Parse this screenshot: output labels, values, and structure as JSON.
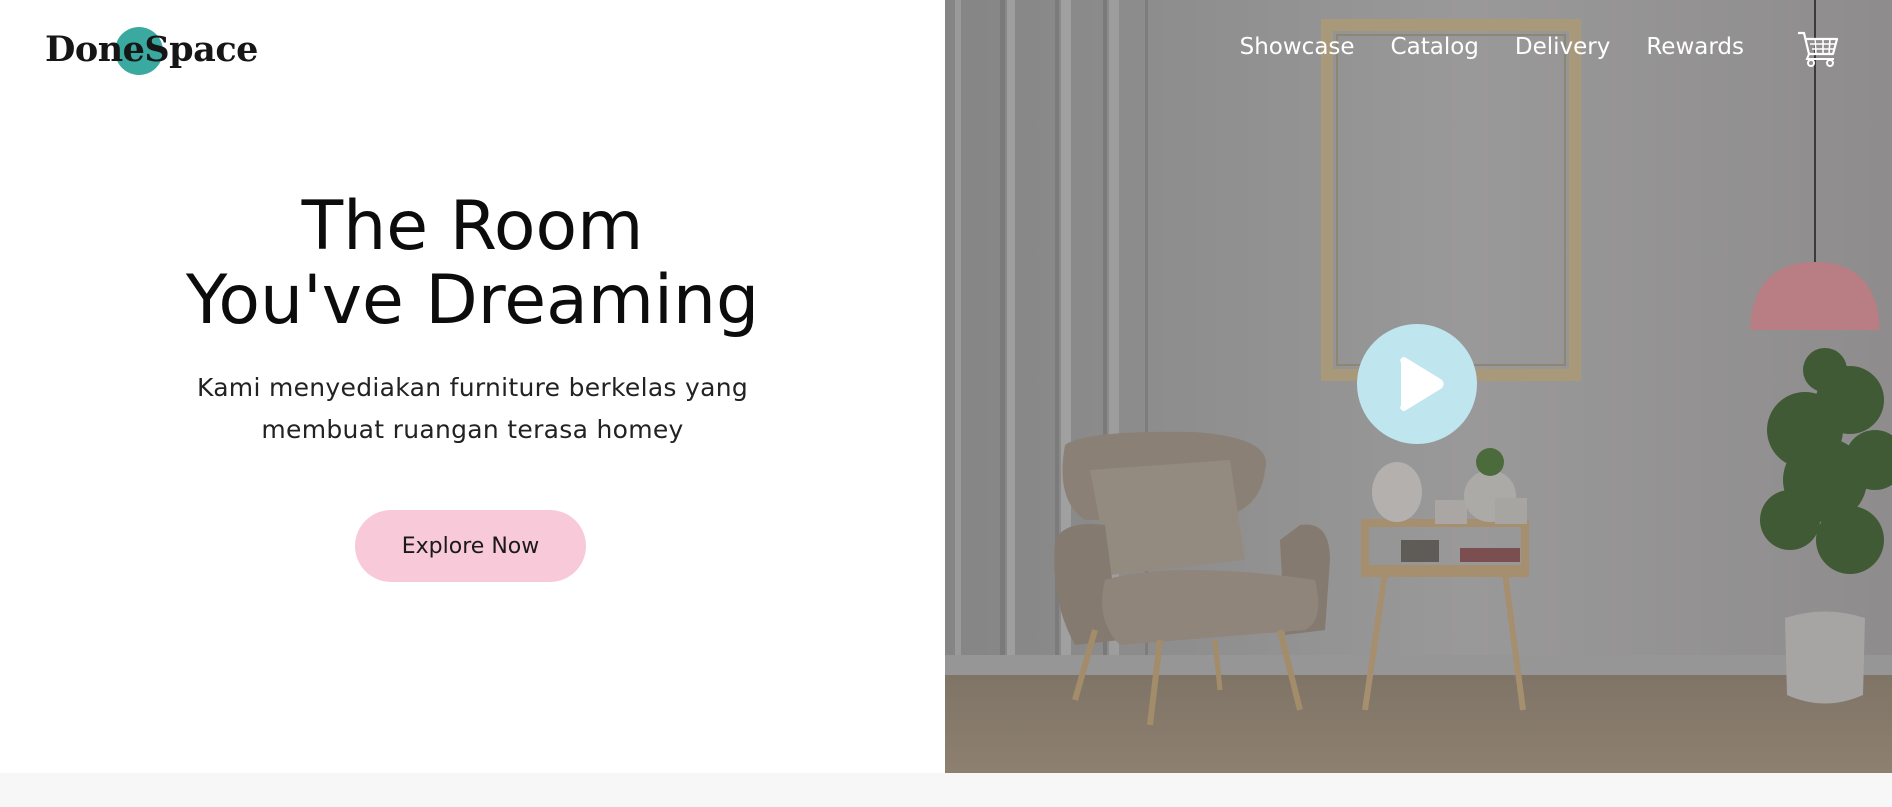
{
  "brand": {
    "name": "DoneSpace"
  },
  "nav": {
    "items": [
      {
        "label": "Showcase"
      },
      {
        "label": "Catalog"
      },
      {
        "label": "Delivery"
      },
      {
        "label": "Rewards"
      }
    ],
    "cart_icon": "cart-icon"
  },
  "hero": {
    "headline_line1": "The Room",
    "headline_line2": "You've Dreaming",
    "subtext_line1": "Kami menyediakan furniture berkelas yang",
    "subtext_line2": "membuat ruangan terasa homey",
    "cta_label": "Explore Now",
    "play_icon": "play-icon"
  },
  "colors": {
    "accent_teal": "#3aa99f",
    "cta_pink": "#f8c9d9",
    "play_blue": "#bfe5ef"
  }
}
